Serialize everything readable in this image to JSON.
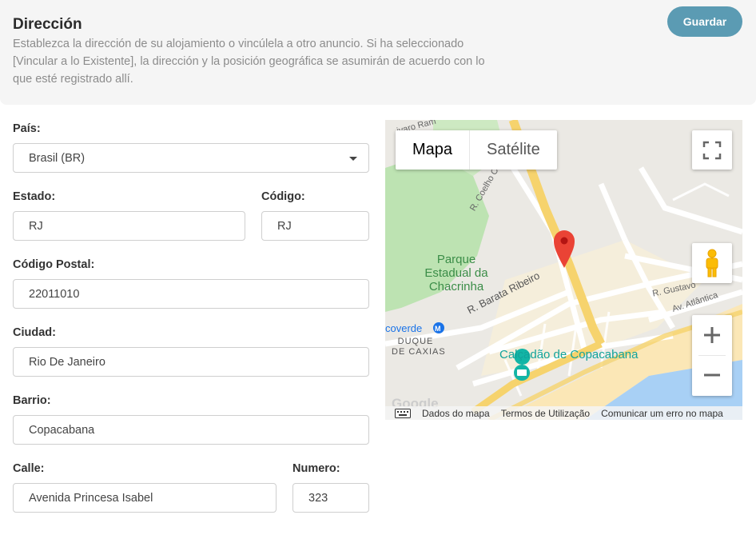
{
  "header": {
    "title": "Dirección",
    "description": "Establezca la dirección de su alojamiento o vincúlela a otro anuncio. Si ha seleccionado [Vincular a lo Existente], la dirección y la posición geográfica se asumirán de acuerdo con lo que esté registrado allí.",
    "save_label": "Guardar"
  },
  "form": {
    "pais": {
      "label": "País:",
      "value": "Brasil (BR)"
    },
    "estado": {
      "label": "Estado:",
      "value": "RJ"
    },
    "codigo": {
      "label": "Código:",
      "value": "RJ"
    },
    "codigo_postal": {
      "label": "Código Postal:",
      "value": "22011010"
    },
    "ciudad": {
      "label": "Ciudad:",
      "value": "Rio De Janeiro"
    },
    "barrio": {
      "label": "Barrio:",
      "value": "Copacabana"
    },
    "calle": {
      "label": "Calle:",
      "value": "Avenida Princesa Isabel"
    },
    "numero": {
      "label": "Numero:",
      "value": "323"
    }
  },
  "map": {
    "type_active": "Mapa",
    "type_inactive": "Satélite",
    "labels": {
      "park": [
        "Parque",
        "Estadual da",
        "Chacrinha"
      ],
      "street_barata": "R. Barata Ribeiro",
      "street_coelho": "R. Coelho Cintra",
      "street_gustavo": "R. Gustavo",
      "street_atlantica": "Av. Atlântica",
      "metro": "coverde",
      "duque": [
        "DUQUE",
        "DE CAXIAS"
      ],
      "calcadao": "Calçadão de Copacabana",
      "raul": "ivaro Ram",
      "google": "Google"
    },
    "footer": {
      "data": "Dados do mapa",
      "terms": "Termos de Utilização",
      "report": "Comunicar um erro no mapa"
    },
    "colors": {
      "park": "#bde3b2",
      "water": "#a8d0f5",
      "beach": "#fbe7b6",
      "road": "#ffffff",
      "highway": "#f6d36d",
      "marker": "#ea4335"
    }
  }
}
